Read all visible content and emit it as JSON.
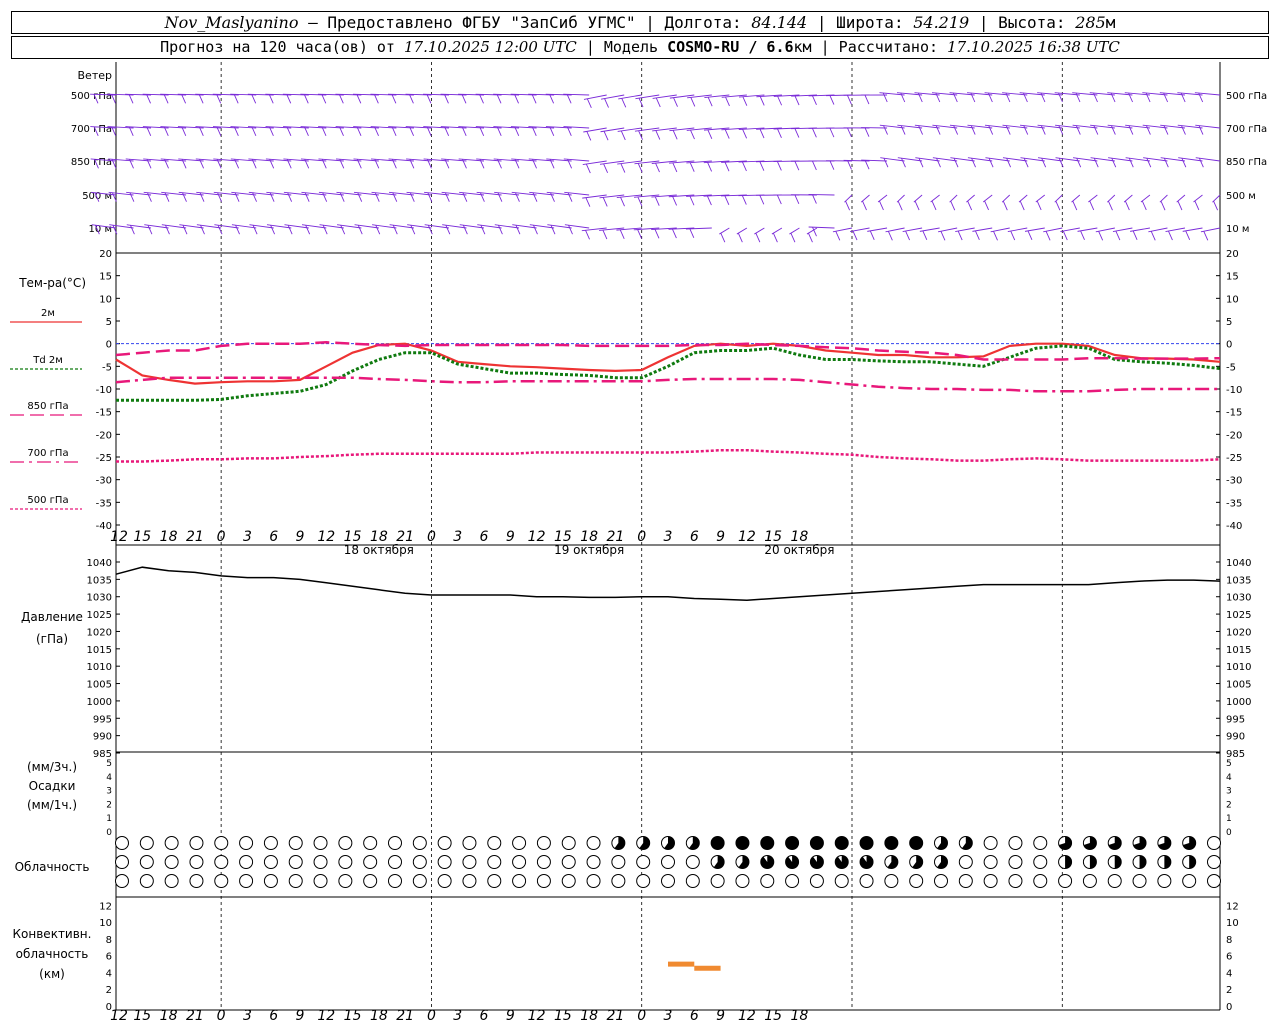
{
  "header": {
    "station": "Nov_Maslyanino",
    "provider": "— Предоставлено ФГБУ \"ЗапСиб УГМС\"",
    "lon_label": "| Долгота:",
    "lon": "84.144",
    "lat_label": "| Широта:",
    "lat": "54.219",
    "alt_label": "| Высота:",
    "alt": "285",
    "alt_unit": "м",
    "fc_prefix": "Прогноз на 120 часа(ов) от",
    "fc_from": "17.10.2025 12:00 UTC",
    "model_label": "| Модель",
    "model": "COSMO-RU / 6.6",
    "model_unit": "км",
    "calc_label": "| Рассчитано:",
    "calc": "17.10.2025 16:38 UTC"
  },
  "time_axis": {
    "hour_labels": [
      "12",
      "15",
      "18",
      "21",
      "0",
      "3",
      "6",
      "9",
      "12",
      "15",
      "18",
      "21",
      "0",
      "3",
      "6",
      "9",
      "12",
      "15",
      "18",
      "21",
      "0",
      "3",
      "6",
      "9",
      "12",
      "15",
      "18"
    ],
    "date_labels": [
      {
        "text": "18 октября",
        "index": 8
      },
      {
        "text": "19 октября",
        "index": 16
      },
      {
        "text": "20 октября",
        "index": 24
      }
    ]
  },
  "wind": {
    "title": "Ветер",
    "levels": [
      "500 гПа",
      "700 гПа",
      "850 гПа",
      "500 м",
      "10 м"
    ],
    "line_color": "#7a2bd8"
  },
  "temperature": {
    "title": "Тем-ра(°С)",
    "ticks": [
      20,
      15,
      10,
      5,
      0,
      -5,
      -10,
      -15,
      -20,
      -25,
      -30,
      -35,
      -40
    ],
    "legend": [
      "2м",
      "Td  2м",
      "850 гПа",
      "700 гПа",
      "500 гПа"
    ]
  },
  "pressure": {
    "title": "Давление",
    "unit": "(гПа)",
    "ticks": [
      1040,
      1035,
      1030,
      1025,
      1020,
      1015,
      1010,
      1005,
      1000,
      995,
      990,
      985
    ]
  },
  "precip": {
    "unit1": "(мм/3ч.)",
    "title": "Осадки",
    "unit2": "(мм/1ч.)",
    "ticks": [
      5,
      4,
      3,
      2,
      1,
      0
    ]
  },
  "cloud": {
    "title": "Облачность",
    "row_count": 3,
    "symbols_per_row": 45
  },
  "convective": {
    "title1": "Конвективн.",
    "title2": "облачность",
    "unit": "(км)",
    "ticks": [
      12,
      10,
      8,
      6,
      4,
      2,
      0
    ],
    "color": "#f08a30"
  },
  "chart_data": [
    {
      "type": "line",
      "title": "Тем-ра(°С)",
      "x_hours": [
        0,
        3,
        6,
        9,
        12,
        15,
        18,
        21,
        24,
        27,
        30,
        33,
        36,
        39,
        42,
        45,
        48,
        51,
        54,
        57,
        60,
        63,
        66,
        69,
        72,
        75,
        78,
        81,
        84,
        87,
        90,
        93,
        96,
        99,
        102,
        105,
        108,
        111,
        114,
        117,
        120,
        123,
        126
      ],
      "ylim": [
        -40,
        20
      ],
      "series": [
        {
          "name": "2м",
          "color": "#ee3333",
          "style": "solid",
          "values": [
            -3.5,
            -7,
            -8,
            -8.8,
            -8.5,
            -8.3,
            -8.3,
            -8,
            -5,
            -2,
            -0.3,
            0,
            -1.5,
            -4,
            -4.5,
            -5,
            -5.2,
            -5.5,
            -5.8,
            -6,
            -5.8,
            -3,
            -0.5,
            0,
            -0.5,
            0,
            -0.5,
            -1.5,
            -2,
            -2.5,
            -2.5,
            -3,
            -3,
            -2.8,
            -0.5,
            0,
            0,
            -0.5,
            -2.5,
            -3.2,
            -3.3,
            -3.5,
            -4
          ]
        },
        {
          "name": "Td  2м",
          "color": "#0f7a0f",
          "style": "dotted",
          "values": [
            -12.5,
            -12.5,
            -12.5,
            -12.5,
            -12.3,
            -11.5,
            -11,
            -10.5,
            -9,
            -6,
            -3.5,
            -2,
            -2,
            -4.5,
            -5.5,
            -6.5,
            -6.5,
            -6.8,
            -7,
            -7.5,
            -7.5,
            -5,
            -2,
            -1.5,
            -1.5,
            -1,
            -2.5,
            -3.5,
            -3.5,
            -3.8,
            -4,
            -4,
            -4.5,
            -5,
            -3,
            -1,
            -0.5,
            -1,
            -3.5,
            -4,
            -4.3,
            -4.8,
            -5.5
          ]
        },
        {
          "name": "850 гПа",
          "color": "#e8187a",
          "style": "longdash",
          "values": [
            -2.5,
            -2,
            -1.5,
            -1.5,
            -0.5,
            0,
            0,
            0,
            0.3,
            0,
            -0.3,
            -0.5,
            -0.3,
            -0.3,
            -0.3,
            -0.3,
            -0.3,
            -0.3,
            -0.5,
            -0.5,
            -0.5,
            -0.5,
            -0.3,
            -0.3,
            0,
            -0.3,
            -0.5,
            -0.8,
            -1,
            -1.5,
            -1.8,
            -2,
            -2.5,
            -3.5,
            -3.5,
            -3.5,
            -3.5,
            -3.2,
            -3.2,
            -3.3,
            -3.3,
            -3.3,
            -3.2
          ]
        },
        {
          "name": "700 гПа",
          "color": "#e8187a",
          "style": "dashdot",
          "values": [
            -8.5,
            -8,
            -7.5,
            -7.5,
            -7.5,
            -7.5,
            -7.5,
            -7.5,
            -7.5,
            -7.5,
            -7.8,
            -8,
            -8.3,
            -8.5,
            -8.5,
            -8.3,
            -8.3,
            -8.3,
            -8.3,
            -8.3,
            -8.3,
            -8,
            -7.8,
            -7.8,
            -7.8,
            -7.8,
            -8,
            -8.5,
            -9,
            -9.5,
            -9.8,
            -10,
            -10,
            -10.2,
            -10.2,
            -10.5,
            -10.5,
            -10.5,
            -10.2,
            -10,
            -10,
            -10,
            -10
          ]
        },
        {
          "name": "500 гПа",
          "color": "#e8187a",
          "style": "dotted",
          "values": [
            -26,
            -26,
            -25.8,
            -25.5,
            -25.5,
            -25.3,
            -25.3,
            -25,
            -24.8,
            -24.5,
            -24.3,
            -24.3,
            -24.3,
            -24.3,
            -24.3,
            -24.3,
            -24,
            -24,
            -24,
            -24,
            -24,
            -24,
            -23.8,
            -23.5,
            -23.5,
            -23.8,
            -24,
            -24.3,
            -24.5,
            -25,
            -25.3,
            -25.5,
            -25.8,
            -25.8,
            -25.5,
            -25.3,
            -25.5,
            -25.8,
            -25.8,
            -25.8,
            -25.8,
            -25.8,
            -25.5
          ]
        }
      ]
    },
    {
      "type": "line",
      "title": "Давление",
      "ylabel": "(гПа)",
      "ylim": [
        985,
        1040
      ],
      "x_hours": [
        0,
        3,
        6,
        9,
        12,
        15,
        18,
        21,
        24,
        27,
        30,
        33,
        36,
        39,
        42,
        45,
        48,
        51,
        54,
        57,
        60,
        63,
        66,
        69,
        72,
        75,
        78,
        81,
        84,
        87,
        90,
        93,
        96,
        99,
        102,
        105,
        108,
        111,
        114,
        117,
        120,
        123,
        126
      ],
      "series": [
        {
          "color": "#000000",
          "values": [
            1036.5,
            1038.5,
            1037.5,
            1037,
            1036,
            1035.5,
            1035.5,
            1035,
            1034,
            1033,
            1032,
            1031,
            1030.5,
            1030.5,
            1030.5,
            1030.5,
            1030,
            1030,
            1029.8,
            1029.8,
            1030,
            1030,
            1029.5,
            1029.3,
            1029,
            1029.5,
            1030,
            1030.5,
            1031,
            1031.5,
            1032,
            1032.5,
            1033,
            1033.5,
            1033.5,
            1033.5,
            1033.5,
            1033.5,
            1034,
            1034.5,
            1034.8,
            1034.8,
            1034.5
          ]
        }
      ]
    },
    {
      "type": "bar",
      "title": "Конвективн. облачность",
      "ylabel": "(км)",
      "ylim": [
        0,
        14
      ],
      "segments": [
        {
          "h_start": 63,
          "h_end": 66,
          "height_km": 5
        },
        {
          "h_start": 66,
          "h_end": 69,
          "height_km": 4.5
        }
      ]
    }
  ]
}
